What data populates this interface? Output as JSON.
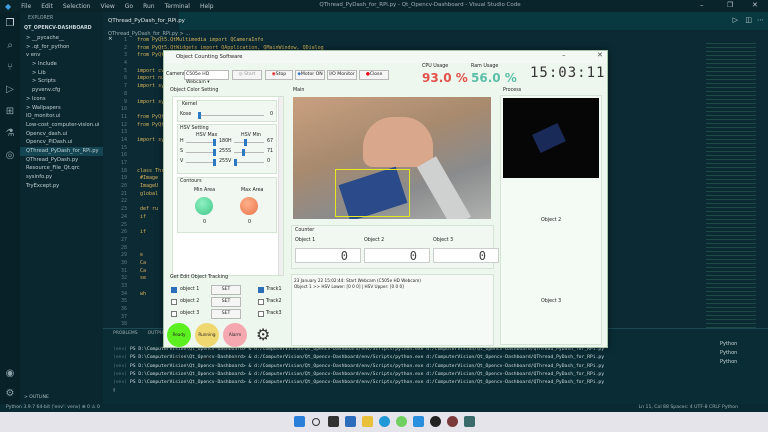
{
  "vscode": {
    "menu": [
      "File",
      "Edit",
      "Selection",
      "View",
      "Go",
      "Run",
      "Terminal",
      "Help"
    ],
    "window_title": "QThread_PyDash_for_RPi.py - Qt_Opencv-Dashboard - Visual Studio Code",
    "explorer_header": "EXPLORER",
    "project": "QT_OPENCV-DASHBOARD",
    "tree": [
      "> __pycache__",
      "> .qt_for_python",
      "v env",
      "> Include",
      "> Lib",
      "> Scripts",
      "pyvenv.cfg",
      "> Icons",
      "> Wallpapers",
      "IO_monitor.ui",
      "Low-cost_computer-vision.ui",
      "Opencv_dash.ui",
      "Opencv_PiDash.ui",
      "QThread_PyDash_for_RPi.py",
      "QThread_PyDash.py",
      "Resource_File_Qt.qrc",
      "sysinfo.py",
      "TryExcept.py"
    ],
    "outline": "> OUTLINE",
    "tab": "QThread_PyDash_for_RPi.py ×",
    "breadcrumb": "QThread_PyDash_for_RPi.py > ...",
    "code": [
      "from PyQt5.QtMultimedia import QCameraInfo",
      "from PyQt5.QtWidgets import QApplication, QMainWindow, QDialog",
      "from PyQt5.",
      "",
      "import cv",
      "import num",
      "import sys",
      "",
      "import sys",
      "",
      "from PyQt5",
      "from PyQt5",
      "",
      "import sys",
      "",
      "",
      "",
      "class Thre",
      "    #Image",
      "    ImageU",
      "    global",
      "",
      "    def ru",
      "        if",
      "",
      "        if",
      "",
      "",
      "        e",
      "        Ca",
      "        Ca",
      "        se",
      "",
      "        wh",
      "",
      "",
      "",
      ""
    ],
    "panel_tabs": [
      "PROBLEMS",
      "OUTPUT"
    ],
    "terminal": [
      {
        "prefix": "(env)",
        "text": "PS D:\\ComputerVision\\Qt_Opencv-Dashboard> & d:/ComputerVision/Qt_Opencv-Dashboard/env/Scripts/python.exe d:/ComputerVision/Qt_Opencv-Dashboard/QThread_PyDash_for_RPi.py"
      },
      {
        "prefix": "(env)",
        "text": "PS D:\\ComputerVision\\Qt_Opencv-Dashboard> & d:/ComputerVision/Qt_Opencv-Dashboard/env/Scripts/python.exe d:/ComputerVision/Qt_Opencv-Dashboard/QThread_PyDash_for_RPi.py"
      },
      {
        "prefix": "(env)",
        "text": "PS D:\\ComputerVision\\Qt_Opencv-Dashboard> & d:/ComputerVision/Qt_Opencv-Dashboard/env/Scripts/python.exe d:/ComputerVision/Qt_Opencv-Dashboard/QThread_PyDash_for_RPi.py"
      },
      {
        "prefix": "(env)",
        "text": "PS D:\\ComputerVision\\Qt_Opencv-Dashboard> & d:/ComputerVision/Qt_Opencv-Dashboard/env/Scripts/python.exe d:/ComputerVision/Qt_Opencv-Dashboard/QThread_PyDash_for_RPi.py"
      },
      {
        "prefix": "(env)",
        "text": "PS D:\\ComputerVision\\Qt_Opencv-Dashboard> & d:/ComputerVision/Qt_Opencv-Dashboard/env/Scripts/python.exe d:/ComputerVision/Qt_Opencv-Dashboard/QThread_PyDash_for_RPi.py"
      }
    ],
    "terminal_list": [
      "Python",
      "Python",
      "Python"
    ],
    "status_left": "Python 3.9.7 64-bit ('env': venv)   ⊗ 0 ⚠ 0",
    "status_right": "Ln 11, Col 88   Spaces: 4   UTF-8   CRLF   Python"
  },
  "app": {
    "title": "Object Counting Software",
    "camera_label": "Camera",
    "camera_value": "C505e HD Webcam ▾",
    "buttons": {
      "start": "Start",
      "stop": "Stop",
      "motor": "Motor ON",
      "io": "I/O Monitor",
      "close": "Close"
    },
    "cpu_label": "CPU Usage",
    "cpu_value": "93.0 %",
    "ram_label": "Ram Usage",
    "ram_value": "56.0 %",
    "clock": "15:03:11",
    "colors": {
      "cpu": "#e0524a",
      "ram": "#5bbfa8"
    },
    "color_setting": {
      "title": "Object Color Setting",
      "kernel": "Kernel",
      "kernel_label": "Kose",
      "kernel_value": "0",
      "hsv": "HSV Setting",
      "hsv_max": "HSV Max",
      "hsv_min": "HSV Min",
      "max": [
        {
          "ch": "H",
          "v": "180",
          "f": 1.0
        },
        {
          "ch": "S",
          "v": "255",
          "f": 1.0
        },
        {
          "ch": "V",
          "v": "255",
          "f": 1.0
        }
      ],
      "min": [
        {
          "ch": "H",
          "v": "67",
          "f": 0.37
        },
        {
          "ch": "S",
          "v": "71",
          "f": 0.28
        },
        {
          "ch": "V",
          "v": "0",
          "f": 0.0
        }
      ],
      "contours": "Contours",
      "min_area": "Min Area",
      "max_area": "Max Area",
      "min_area_value": "0",
      "max_area_value": "0"
    },
    "tracking": {
      "title": "Get Edit Object  Tracking",
      "rows": [
        {
          "obj": "object 1",
          "checked": true,
          "set": "SET",
          "track": "Track1",
          "tchecked": true
        },
        {
          "obj": "object 2",
          "checked": false,
          "set": "SET",
          "track": "Track2",
          "tchecked": false
        },
        {
          "obj": "object 3",
          "checked": false,
          "set": "SET",
          "track": "Track3",
          "tchecked": false
        }
      ]
    },
    "lights": {
      "ready": "Ready Light",
      "running": "Running Light",
      "alarm": "Alarm Light"
    },
    "main_label": "Main",
    "process_label": "Process",
    "object2": "Object 2",
    "object3": "Object 3",
    "counter": {
      "title": "Counter",
      "items": [
        {
          "label": "Object 1",
          "value": "0"
        },
        {
          "label": "Object 2",
          "value": "0"
        },
        {
          "label": "Object 3",
          "value": "0"
        }
      ]
    },
    "log": [
      "23 January 22 15:02:44: Start Webcam (C505e HD Webcam)",
      "Object 1 >> HSV Lower: [0 0 0] | HSV Upper: [0 0 0]"
    ]
  }
}
